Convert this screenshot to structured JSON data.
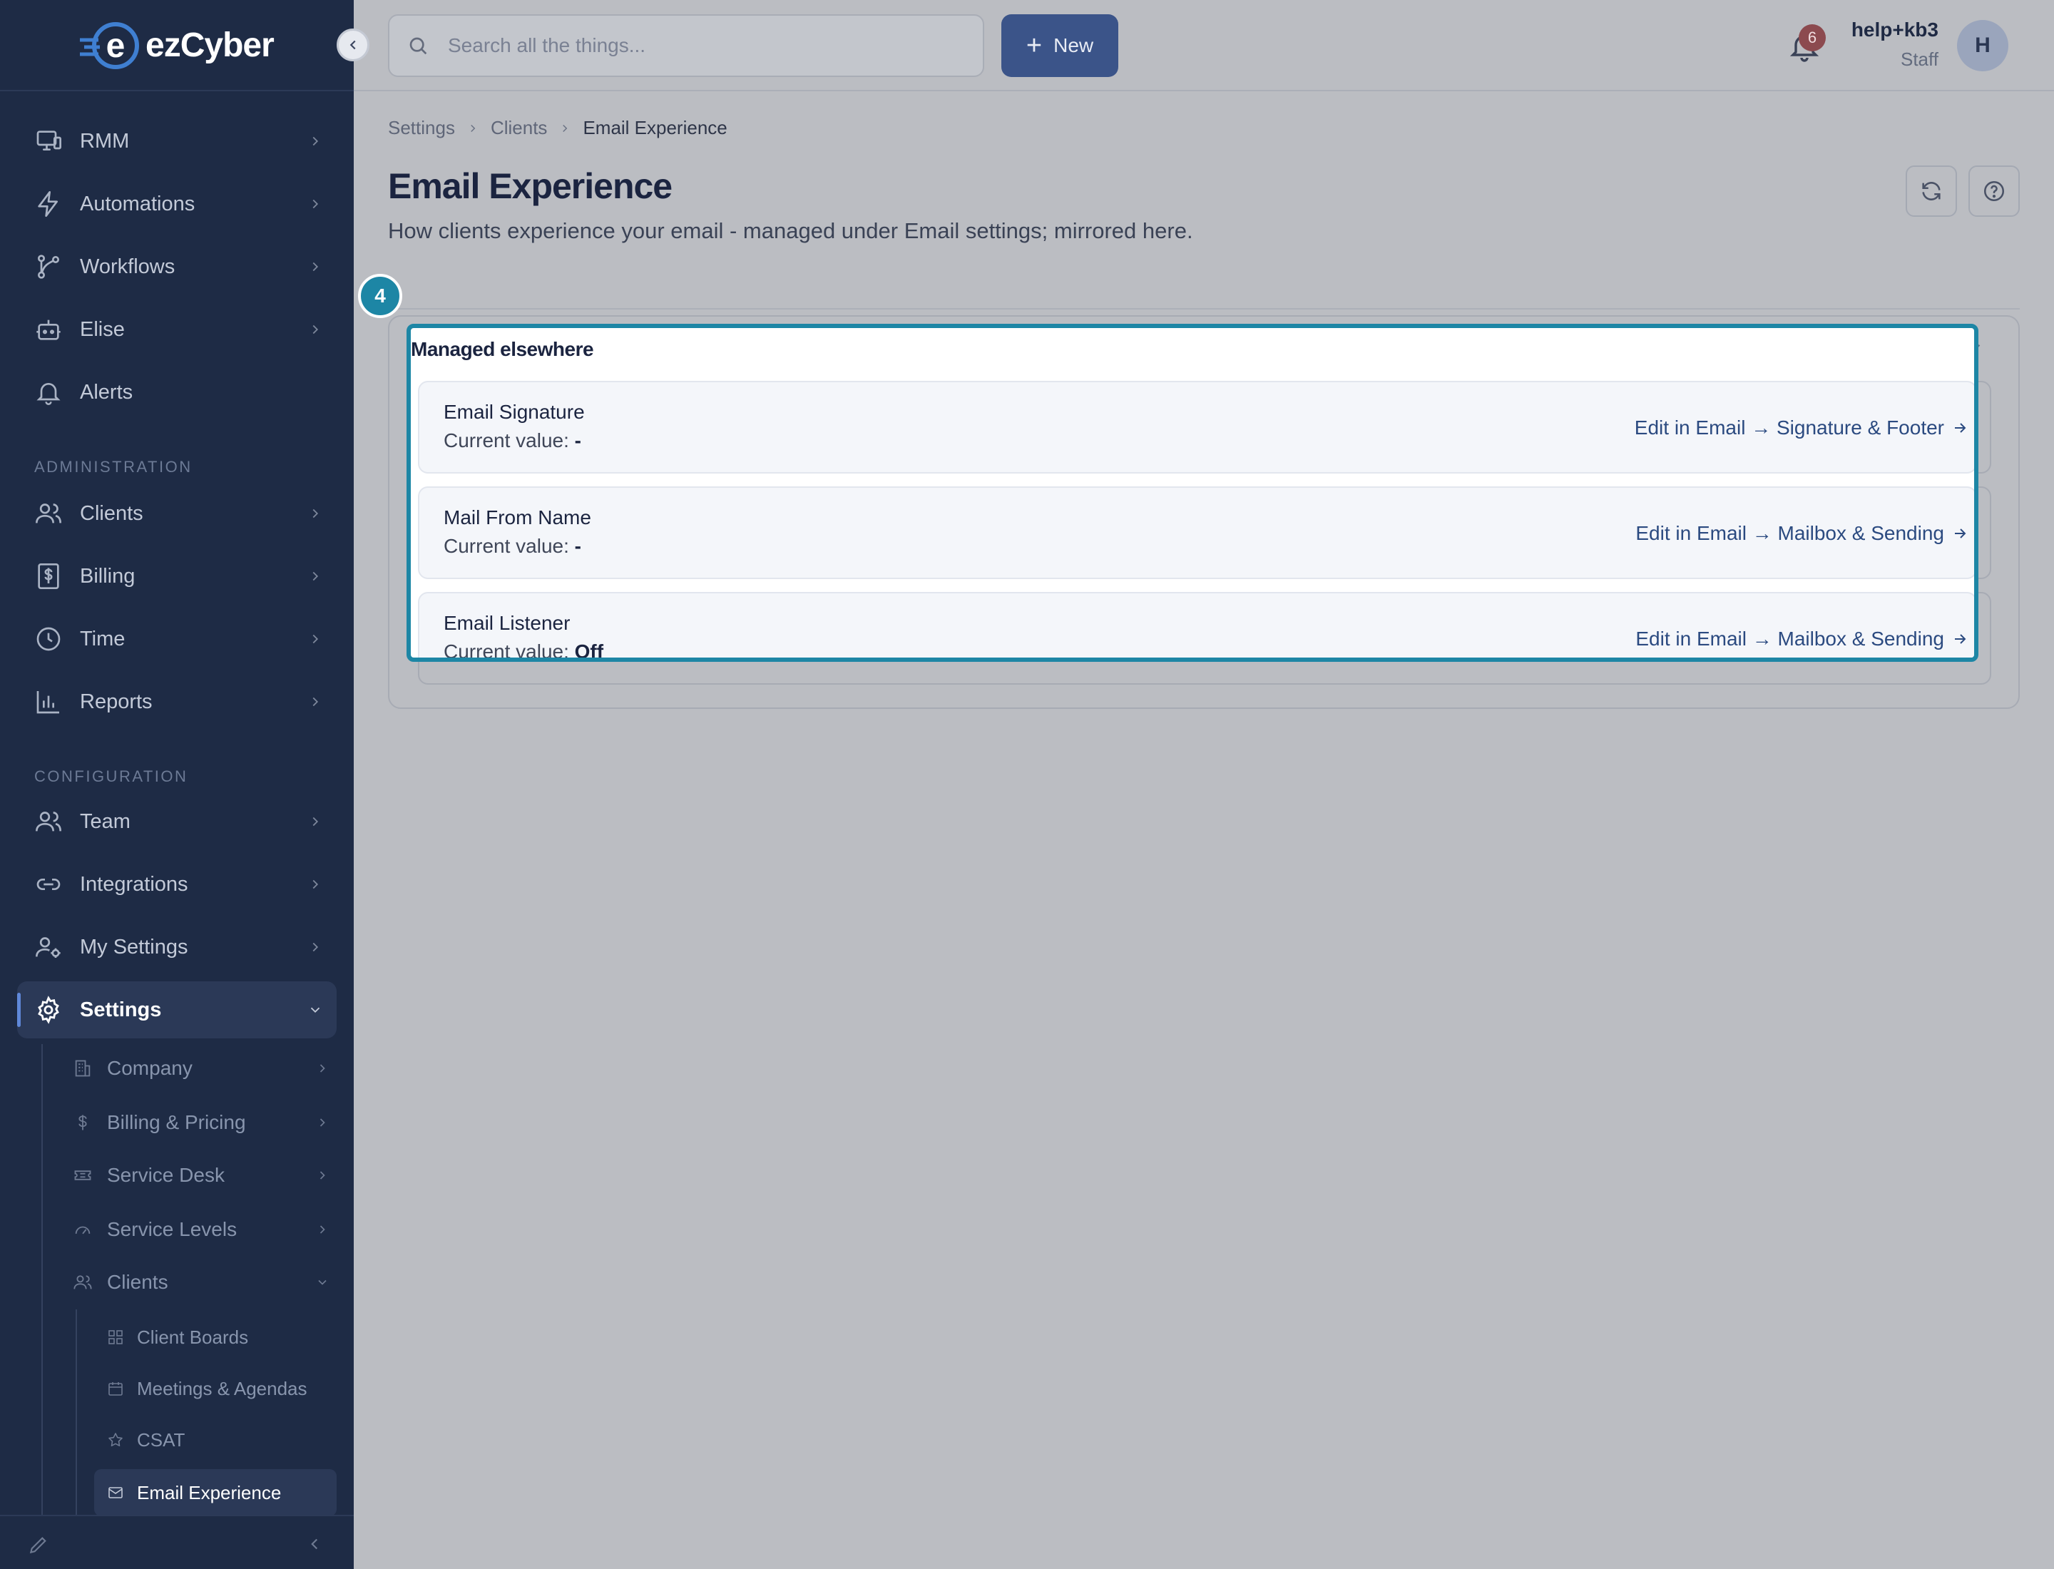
{
  "app": {
    "logo_ez": "ez",
    "logo_cyber": "Cyber"
  },
  "sidebar": {
    "main_items": [
      {
        "label": "RMM",
        "icon": "monitor-icon"
      },
      {
        "label": "Automations",
        "icon": "lightning-icon"
      },
      {
        "label": "Workflows",
        "icon": "workflow-icon"
      },
      {
        "label": "Elise",
        "icon": "bot-icon"
      },
      {
        "label": "Alerts",
        "icon": "bell-icon"
      }
    ],
    "section_admin": "ADMINISTRATION",
    "admin_items": [
      {
        "label": "Clients",
        "icon": "users-icon"
      },
      {
        "label": "Billing",
        "icon": "dollar-receipt-icon"
      },
      {
        "label": "Time",
        "icon": "clock-icon"
      },
      {
        "label": "Reports",
        "icon": "bar-chart-icon"
      }
    ],
    "section_config": "CONFIGURATION",
    "config_items": [
      {
        "label": "Team",
        "icon": "users-icon"
      },
      {
        "label": "Integrations",
        "icon": "link-icon"
      },
      {
        "label": "My Settings",
        "icon": "user-gear-icon"
      },
      {
        "label": "Settings",
        "icon": "gear-icon"
      }
    ],
    "settings_sub": [
      {
        "label": "Company",
        "icon": "building-icon"
      },
      {
        "label": "Billing & Pricing",
        "icon": "dollar-icon"
      },
      {
        "label": "Service Desk",
        "icon": "ticket-icon"
      },
      {
        "label": "Service Levels",
        "icon": "gauge-icon"
      },
      {
        "label": "Clients",
        "icon": "users-icon"
      }
    ],
    "clients_sub": [
      {
        "label": "Client Boards",
        "icon": "grid-icon"
      },
      {
        "label": "Meetings & Agendas",
        "icon": "calendar-icon"
      },
      {
        "label": "CSAT",
        "icon": "star-icon"
      },
      {
        "label": "Email Experience",
        "icon": "mail-icon"
      }
    ]
  },
  "topbar": {
    "search_placeholder": "Search all the things...",
    "new_label": "New",
    "notifications_count": "6",
    "user_name": "help+kb3",
    "user_role": "Staff",
    "avatar_initial": "H"
  },
  "breadcrumb": [
    "Settings",
    "Clients",
    "Email Experience"
  ],
  "page": {
    "title": "Email Experience",
    "subtitle": "How clients experience your email - managed under Email settings; mirrored here."
  },
  "step_badge": "4",
  "managed": {
    "title": "Managed elsewhere",
    "rows": [
      {
        "name": "Email Signature",
        "value_prefix": "Current value:",
        "value": "-",
        "link": "Edit in Email → Signature & Footer"
      },
      {
        "name": "Mail From Name",
        "value_prefix": "Current value:",
        "value": "-",
        "link": "Edit in Email → Mailbox & Sending"
      },
      {
        "name": "Email Listener",
        "value_prefix": "Current value:",
        "value": "Off",
        "link": "Edit in Email → Mailbox & Sending"
      }
    ]
  },
  "colors": {
    "sidebar_bg": "#1e2b45",
    "accent": "#1d86a5",
    "primary_button": "#3b5489",
    "link": "#2b4a80"
  }
}
